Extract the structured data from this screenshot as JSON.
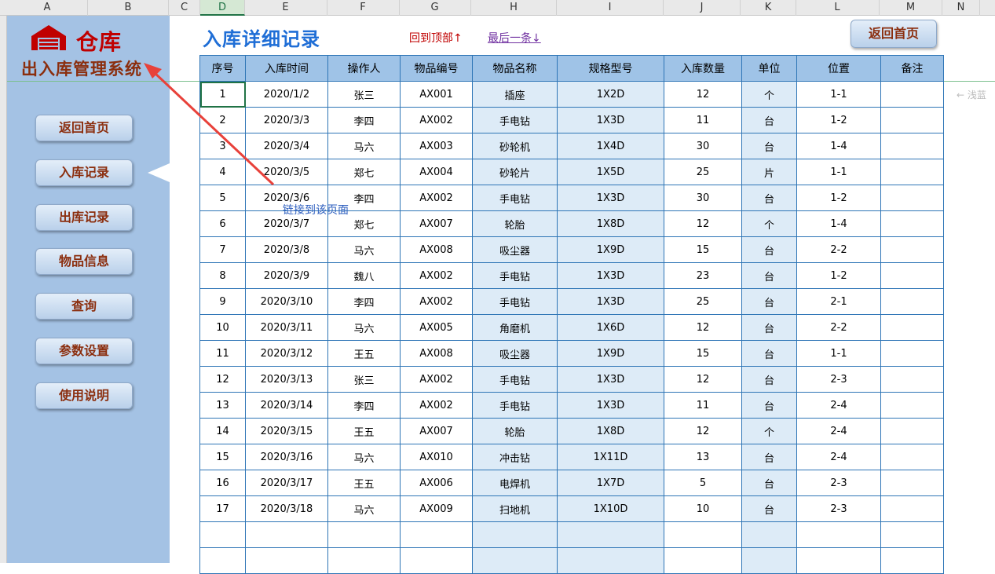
{
  "columns": [
    "A",
    "B",
    "C",
    "D",
    "E",
    "F",
    "G",
    "H",
    "I",
    "J",
    "K",
    "L",
    "M",
    "N"
  ],
  "selected_column": "D",
  "side_panel": {
    "logo_text": "仓库",
    "subtitle": "出入库管理系统",
    "nav": [
      "返回首页",
      "入库记录",
      "出库记录",
      "物品信息",
      "查询",
      "参数设置",
      "使用说明"
    ],
    "active_nav": "入库记录"
  },
  "header": {
    "title": "入库详细记录",
    "link_top": "回到顶部↑",
    "link_end": "最后一条↓",
    "home_button": "返回首页"
  },
  "annotation": "链接到该页面",
  "faint_text": "←   浅蓝",
  "table": {
    "headers": [
      "序号",
      "入库时间",
      "操作人",
      "物品编号",
      "物品名称",
      "规格型号",
      "入库数量",
      "单位",
      "位置",
      "备注"
    ],
    "rows": [
      [
        "1",
        "2020/1/2",
        "张三",
        "AX001",
        "插座",
        "1X2D",
        "12",
        "个",
        "1-1",
        ""
      ],
      [
        "2",
        "2020/3/3",
        "李四",
        "AX002",
        "手电钻",
        "1X3D",
        "11",
        "台",
        "1-2",
        ""
      ],
      [
        "3",
        "2020/3/4",
        "马六",
        "AX003",
        "砂轮机",
        "1X4D",
        "30",
        "台",
        "1-4",
        ""
      ],
      [
        "4",
        "2020/3/5",
        "郑七",
        "AX004",
        "砂轮片",
        "1X5D",
        "25",
        "片",
        "1-1",
        ""
      ],
      [
        "5",
        "2020/3/6",
        "李四",
        "AX002",
        "手电钻",
        "1X3D",
        "30",
        "台",
        "1-2",
        ""
      ],
      [
        "6",
        "2020/3/7",
        "郑七",
        "AX007",
        "轮胎",
        "1X8D",
        "12",
        "个",
        "1-4",
        ""
      ],
      [
        "7",
        "2020/3/8",
        "马六",
        "AX008",
        "吸尘器",
        "1X9D",
        "15",
        "台",
        "2-2",
        ""
      ],
      [
        "8",
        "2020/3/9",
        "魏八",
        "AX002",
        "手电钻",
        "1X3D",
        "23",
        "台",
        "1-2",
        ""
      ],
      [
        "9",
        "2020/3/10",
        "李四",
        "AX002",
        "手电钻",
        "1X3D",
        "25",
        "台",
        "2-1",
        ""
      ],
      [
        "10",
        "2020/3/11",
        "马六",
        "AX005",
        "角磨机",
        "1X6D",
        "12",
        "台",
        "2-2",
        ""
      ],
      [
        "11",
        "2020/3/12",
        "王五",
        "AX008",
        "吸尘器",
        "1X9D",
        "15",
        "台",
        "1-1",
        ""
      ],
      [
        "12",
        "2020/3/13",
        "张三",
        "AX002",
        "手电钻",
        "1X3D",
        "12",
        "台",
        "2-3",
        ""
      ],
      [
        "13",
        "2020/3/14",
        "李四",
        "AX002",
        "手电钻",
        "1X3D",
        "11",
        "台",
        "2-4",
        ""
      ],
      [
        "14",
        "2020/3/15",
        "王五",
        "AX007",
        "轮胎",
        "1X8D",
        "12",
        "个",
        "2-4",
        ""
      ],
      [
        "15",
        "2020/3/16",
        "马六",
        "AX010",
        "冲击钻",
        "1X11D",
        "13",
        "台",
        "2-4",
        ""
      ],
      [
        "16",
        "2020/3/17",
        "王五",
        "AX006",
        "电焊机",
        "1X7D",
        "5",
        "台",
        "2-3",
        ""
      ],
      [
        "17",
        "2020/3/18",
        "马六",
        "AX009",
        "扫地机",
        "1X10D",
        "10",
        "台",
        "2-3",
        ""
      ],
      [
        "",
        "",
        "",
        "",
        "",
        "",
        "",
        "",
        "",
        ""
      ],
      [
        "",
        "",
        "",
        "",
        "",
        "",
        "",
        "",
        "",
        ""
      ]
    ]
  },
  "colors": {
    "panel_blue": "#a4c2e4",
    "header_blue": "#9fc3e7",
    "shade_blue": "#ddebf7",
    "border_blue": "#2e75b6",
    "title_blue": "#1f6ed6",
    "brand_red": "#c00000",
    "button_text": "#8b2e0e",
    "arrow_red": "#e8413a"
  }
}
